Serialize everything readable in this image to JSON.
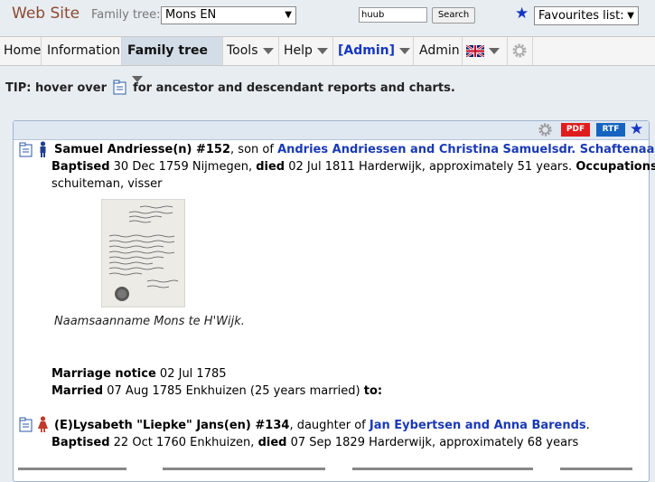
{
  "header": {
    "site_title": "Web Site",
    "family_tree_label": "Family tree:",
    "family_tree_value": "Mons EN",
    "search_value": "huub",
    "search_button": "Search",
    "favourites_label": "Favourites list:"
  },
  "menu": {
    "items": [
      {
        "label": "Home"
      },
      {
        "label": "Information"
      },
      {
        "label": "Family tree"
      },
      {
        "label": "Tools"
      },
      {
        "label": "Help"
      },
      {
        "label": "[Admin]"
      },
      {
        "label": "Admin"
      }
    ]
  },
  "tip": {
    "prefix": "TIP: hover over",
    "suffix": "for ancestor and descendant reports and charts."
  },
  "panel": {
    "pdf_label": "PDF",
    "rtf_label": "RTF"
  },
  "person1": {
    "name_id": "Samuel Andriesse(n) #152",
    "son_of": ", son of ",
    "parents": "Andries Andriessen and Christina Samuelsdr. Schaftenaar",
    "period": ".",
    "baptised_label": "Baptised",
    "baptised_value": " 30 Dec 1759 Nijmegen, ",
    "died_label": "died",
    "died_value": " 02 Jul 1811 Harderwijk, approximately 51 years. ",
    "occupations_label": "Occupations:",
    "occupations_value": "schuiteman, visser",
    "photo_caption": "Naamsaanname Mons te H'Wijk."
  },
  "marriage": {
    "notice_label": "Marriage notice",
    "notice_value": " 02 Jul 1785",
    "married_label": "Married",
    "married_value": " 07 Aug 1785 Enkhuizen (25 years married) ",
    "to_label": "to:"
  },
  "person2": {
    "name_id": "(E)Lysabeth \"Liepke\" Jans(en) #134",
    "daughter_of": ", daughter of ",
    "parents": "Jan Eybertsen and Anna Barends",
    "period": ".",
    "baptised_label": "Baptised",
    "baptised_value": " 22 Oct 1760 Enkhuizen, ",
    "died_label": "died",
    "died_value": " 07 Sep 1829 Harderwijk, approximately 68 years"
  },
  "colors": {
    "accent_link": "#1a39b5",
    "site_title": "#8b4a2f",
    "pdf": "#e01d1d",
    "rtf": "#1565c0"
  }
}
